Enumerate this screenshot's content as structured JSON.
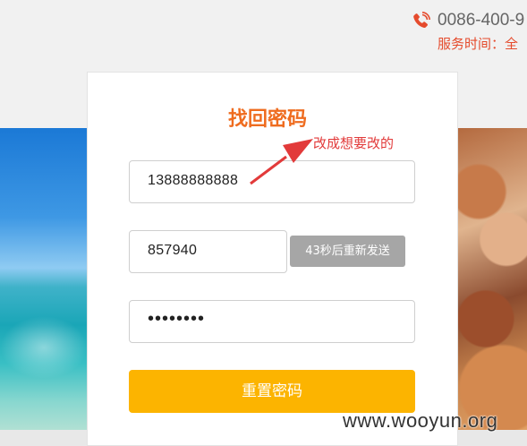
{
  "header": {
    "phone_number": "0086-400-9",
    "service_hours": "服务时间：全"
  },
  "form": {
    "title": "找回密码",
    "phone_value": "13888888888",
    "code_value": "857940",
    "resend_label": "43秒后重新发送",
    "password_masked": "••••••••",
    "reset_label": "重置密码"
  },
  "annotation": {
    "text": "改成想要改的",
    "color": "#e23a3a"
  },
  "watermark": "www.wooyun.org",
  "colors": {
    "accent_orange": "#ef6c1f",
    "button_yellow": "#fcb400",
    "disabled_gray": "#a6a6a6"
  }
}
